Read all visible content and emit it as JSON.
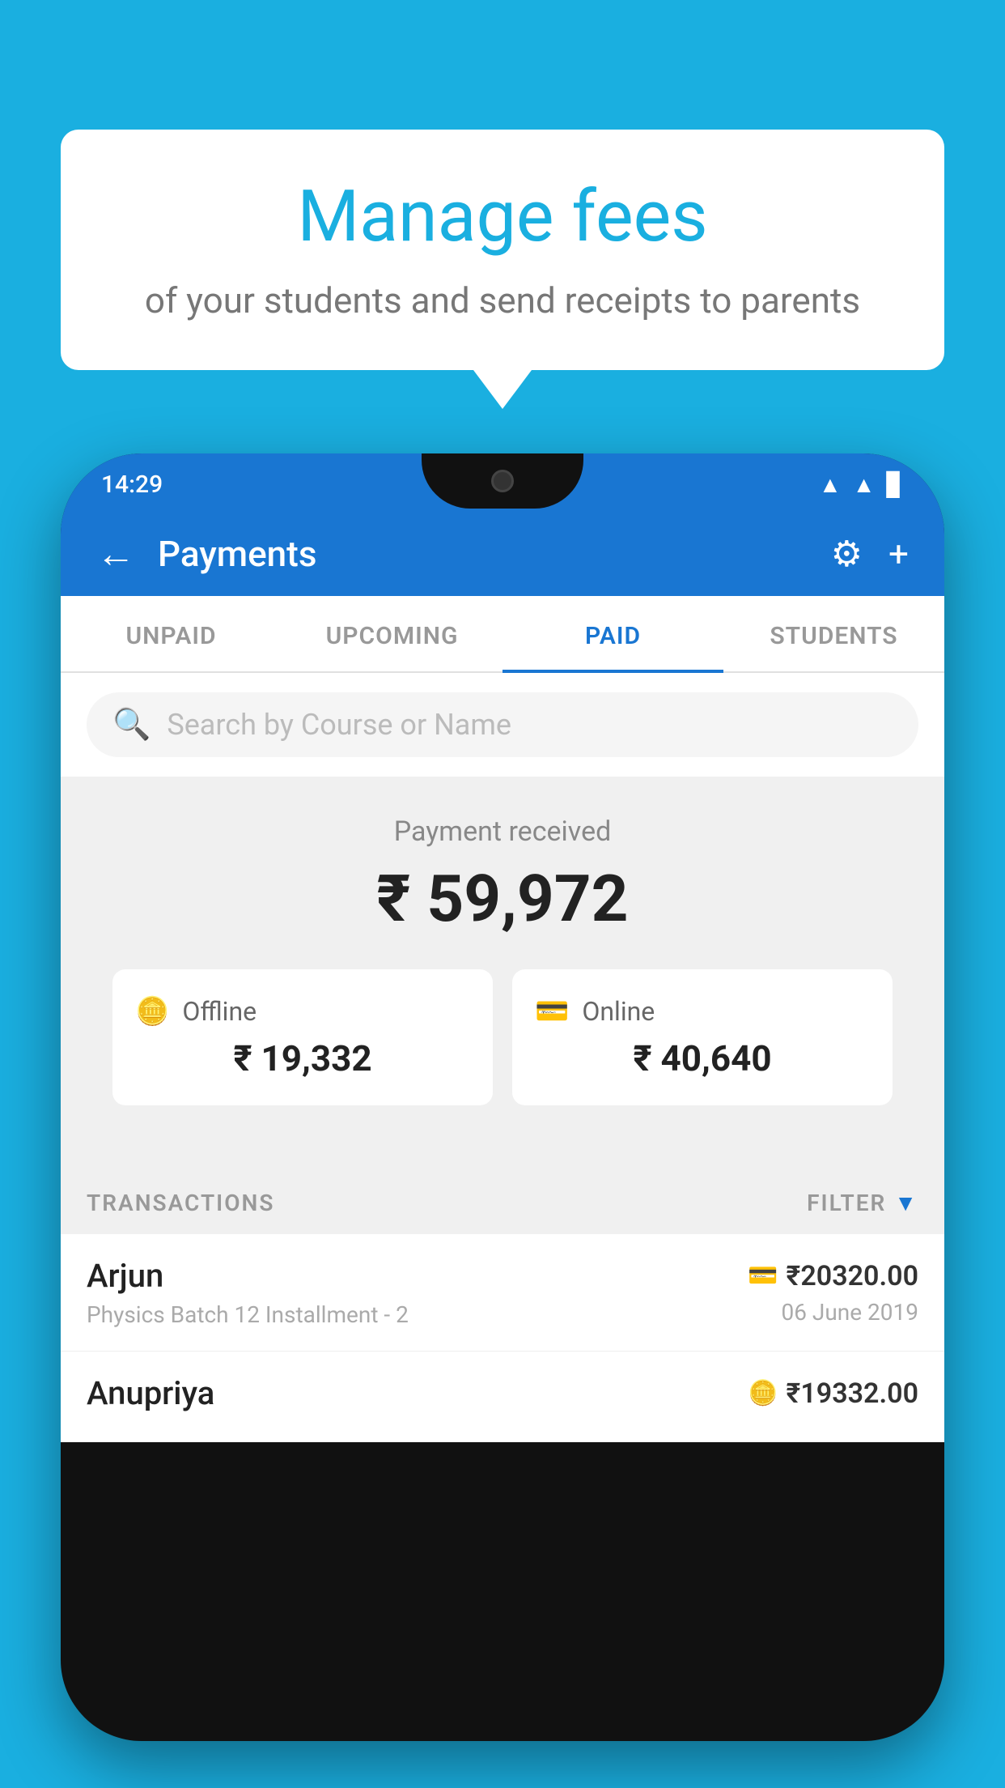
{
  "background_color": "#1AAFE0",
  "speech_bubble": {
    "title": "Manage fees",
    "subtitle": "of your students and send receipts to parents"
  },
  "status_bar": {
    "time": "14:29",
    "icons": [
      "wifi",
      "signal",
      "battery"
    ]
  },
  "app_bar": {
    "title": "Payments",
    "back_icon": "←",
    "settings_icon": "⚙",
    "add_icon": "+"
  },
  "tabs": [
    {
      "label": "UNPAID",
      "active": false
    },
    {
      "label": "UPCOMING",
      "active": false
    },
    {
      "label": "PAID",
      "active": true
    },
    {
      "label": "STUDENTS",
      "active": false
    }
  ],
  "search": {
    "placeholder": "Search by Course or Name"
  },
  "payment_summary": {
    "label": "Payment received",
    "amount": "₹ 59,972",
    "offline_label": "Offline",
    "offline_amount": "₹ 19,332",
    "online_label": "Online",
    "online_amount": "₹ 40,640"
  },
  "transactions": {
    "section_label": "TRANSACTIONS",
    "filter_label": "FILTER",
    "rows": [
      {
        "name": "Arjun",
        "description": "Physics Batch 12 Installment - 2",
        "amount": "₹20320.00",
        "date": "06 June 2019",
        "payment_type": "card"
      },
      {
        "name": "Anupriya",
        "description": "",
        "amount": "₹19332.00",
        "date": "",
        "payment_type": "offline"
      }
    ]
  }
}
